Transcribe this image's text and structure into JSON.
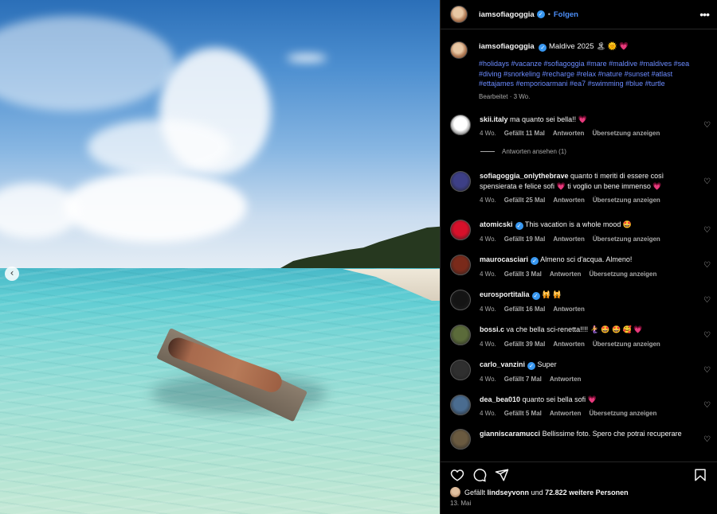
{
  "post": {
    "username": "iamsofiagoggia",
    "separator": "•",
    "follow_label": "Folgen",
    "more_icon": "more-horizontal-icon"
  },
  "caption": {
    "username": "iamsofiagoggia",
    "text": "Maldive 2025 🏝 🌞 💗",
    "hashtags": "#holidays #vacanze #sofiagoggia #mare #maldive #maldives #sea #diving #snorkeling #recharge #relax #nature #sunset #atlast #ettajames #emporioarmani #ea7 #swimming #blue #turtle",
    "meta": "Bearbeitet · 3 Wo."
  },
  "comments": [
    {
      "user": "skii.italy",
      "text": "ma quanto sei bella!! 💗",
      "age": "4 Wo.",
      "likes": "Gefällt 11 Mal",
      "reply": "Antworten",
      "translate": "Übersetzung anzeigen",
      "verified": false,
      "avatar_color": "#ffffff"
    },
    {
      "user": "sofiagoggia_onlythebrave",
      "text": "quanto ti meriti di essere così spensierata e felice sofi 💗 ti voglio un bene immenso 💗",
      "age": "4 Wo.",
      "likes": "Gefällt 25 Mal",
      "reply": "Antworten",
      "translate": "Übersetzung anzeigen",
      "verified": false,
      "avatar_color": "#3d3f86"
    },
    {
      "user": "atomicski",
      "text": "This vacation is a whole mood 🤩",
      "age": "4 Wo.",
      "likes": "Gefällt 19 Mal",
      "reply": "Antworten",
      "translate": "Übersetzung anzeigen",
      "verified": true,
      "avatar_color": "#d8102a"
    },
    {
      "user": "maurocasciari",
      "text": "Almeno sci d'acqua. Almeno!",
      "age": "4 Wo.",
      "likes": "Gefällt 3 Mal",
      "reply": "Antworten",
      "translate": "Übersetzung anzeigen",
      "verified": true,
      "avatar_color": "#7a2a1a"
    },
    {
      "user": "eurosportitalia",
      "text": "🙀 🙀",
      "age": "4 Wo.",
      "likes": "Gefällt 16 Mal",
      "reply": "Antworten",
      "translate": "",
      "verified": true,
      "avatar_color": "#141414"
    },
    {
      "user": "bossi.c",
      "text": "va che bella sci-renetta!!!! 🧜‍♀️ 🤩 🤩 🥰 💗",
      "age": "4 Wo.",
      "likes": "Gefällt 39 Mal",
      "reply": "Antworten",
      "translate": "Übersetzung anzeigen",
      "verified": false,
      "avatar_color": "#5b6b3a"
    },
    {
      "user": "carlo_vanzini",
      "text": "Super",
      "age": "4 Wo.",
      "likes": "Gefällt 7 Mal",
      "reply": "Antworten",
      "translate": "",
      "verified": true,
      "avatar_color": "#2f2f2f"
    },
    {
      "user": "dea_bea010",
      "text": "quanto sei bella sofi 💗",
      "age": "4 Wo.",
      "likes": "Gefällt 5 Mal",
      "reply": "Antworten",
      "translate": "Übersetzung anzeigen",
      "verified": false,
      "avatar_color": "#4a6c90"
    },
    {
      "user": "gianniscaramucci",
      "text": "Bellissime foto. Spero che potrai recuperare",
      "age": "",
      "likes": "",
      "reply": "",
      "translate": "",
      "verified": false,
      "avatar_color": "#6a5a40"
    }
  ],
  "replies_toggle": "Antworten ansehen (1)",
  "footer": {
    "likes_prefix": "Gefällt",
    "likes_user": "lindseyvonn",
    "likes_and": "und",
    "likes_count": "72.822 weitere Personen",
    "date": "13. Mai"
  },
  "icons": {
    "like": "heart-icon",
    "comment": "comment-icon",
    "share": "share-icon",
    "save": "bookmark-icon",
    "prev": "chevron-left-icon"
  },
  "colors": {
    "link": "#4c8ef7",
    "hashtag": "#6b8bff",
    "verified": "#3897f0",
    "muted": "#a8a8a8"
  }
}
